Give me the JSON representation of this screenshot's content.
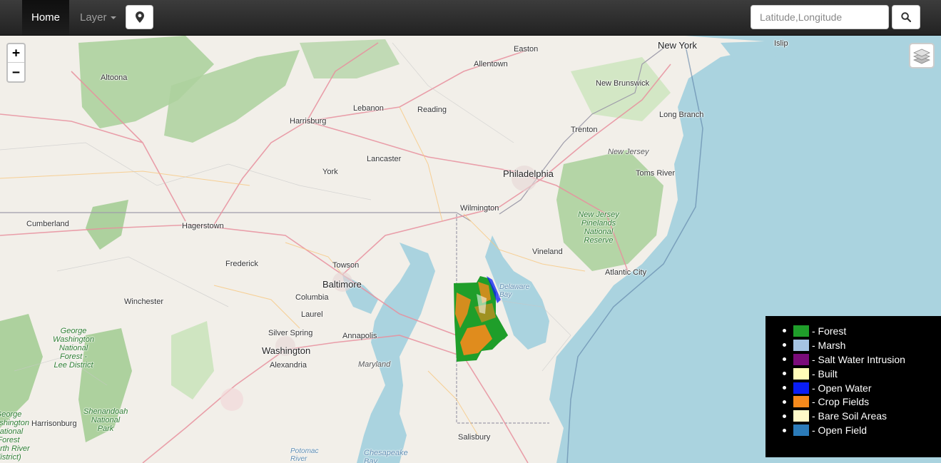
{
  "nav": {
    "home_label": "Home",
    "layer_label": "Layer",
    "search_placeholder": "Latitude,Longitude"
  },
  "zoom": {
    "in_label": "+",
    "out_label": "−"
  },
  "map": {
    "places": [
      {
        "name": "Easton",
        "cls": "city"
      },
      {
        "name": "New York",
        "cls": "big"
      },
      {
        "name": "Islip",
        "cls": "city"
      },
      {
        "name": "Altoona",
        "cls": "city"
      },
      {
        "name": "Allentown",
        "cls": "city"
      },
      {
        "name": "New Brunswick",
        "cls": "city"
      },
      {
        "name": "Lebanon",
        "cls": "city"
      },
      {
        "name": "Reading",
        "cls": "city"
      },
      {
        "name": "Long Branch",
        "cls": "city"
      },
      {
        "name": "Harrisburg",
        "cls": "city"
      },
      {
        "name": "Trenton",
        "cls": "city"
      },
      {
        "name": "New Jersey",
        "cls": "state"
      },
      {
        "name": "Lancaster",
        "cls": "city"
      },
      {
        "name": "York",
        "cls": "city"
      },
      {
        "name": "Philadelphia",
        "cls": "big"
      },
      {
        "name": "Toms River",
        "cls": "city"
      },
      {
        "name": "Wilmington",
        "cls": "city"
      },
      {
        "name": "Cumberland",
        "cls": "city"
      },
      {
        "name": "Hagerstown",
        "cls": "city"
      },
      {
        "name": "New Jersey Pinelands National Reserve",
        "cls": "park"
      },
      {
        "name": "Vineland",
        "cls": "city"
      },
      {
        "name": "Frederick",
        "cls": "city"
      },
      {
        "name": "Towson",
        "cls": "city"
      },
      {
        "name": "Atlantic City",
        "cls": "city"
      },
      {
        "name": "Baltimore",
        "cls": "big"
      },
      {
        "name": "Delaware Bay",
        "cls": "water"
      },
      {
        "name": "Columbia",
        "cls": "city"
      },
      {
        "name": "Winchester",
        "cls": "city"
      },
      {
        "name": "Laurel",
        "cls": "city"
      },
      {
        "name": "George Washington National Forest - Lee District",
        "cls": "park"
      },
      {
        "name": "Silver Spring",
        "cls": "city"
      },
      {
        "name": "Annapolis",
        "cls": "city"
      },
      {
        "name": "Washington",
        "cls": "big"
      },
      {
        "name": "Alexandria",
        "cls": "city"
      },
      {
        "name": "Maryland",
        "cls": "state"
      },
      {
        "name": "Shenandoah National Park",
        "cls": "park"
      },
      {
        "name": "Harrisonburg",
        "cls": "city"
      },
      {
        "name": "George Washington National Forest (North River district)",
        "cls": "park"
      },
      {
        "name": "Salisbury",
        "cls": "city"
      },
      {
        "name": "Potomac River",
        "cls": "water"
      },
      {
        "name": "Chesapeake Bay",
        "cls": "water"
      }
    ]
  },
  "legend": {
    "items": [
      {
        "label": " - Forest",
        "color": "#1f9e2a"
      },
      {
        "label": " - Marsh",
        "color": "#a6c4e3"
      },
      {
        "label": " - Salt Water Intrusion",
        "color": "#7a0c7a"
      },
      {
        "label": " - Built",
        "color": "#fffcb8"
      },
      {
        "label": " - Open Water",
        "color": "#0a1ef5"
      },
      {
        "label": " - Crop Fields",
        "color": "#f5891c"
      },
      {
        "label": " - Bare Soil Areas",
        "color": "#fff9c8"
      },
      {
        "label": " - Open Field",
        "color": "#2b7bb9"
      }
    ]
  },
  "colors": {
    "ocean": "#aad3df",
    "land": "#f2efe9",
    "forest": "#add19e",
    "road": "#e8909e"
  }
}
